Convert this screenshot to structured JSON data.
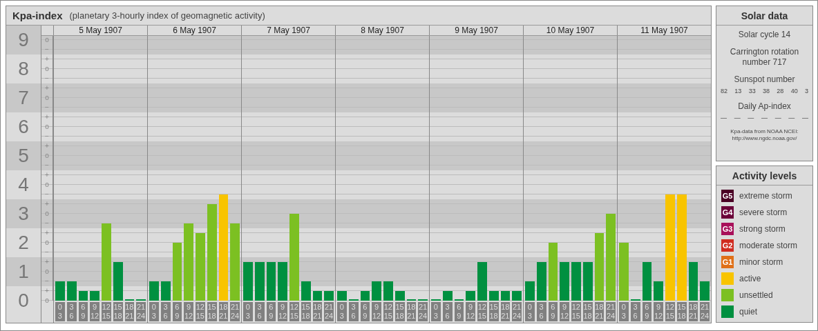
{
  "chart": {
    "title": "Kpa-index",
    "subtitle": "(planetary 3-hourly index of geomagnetic activity)",
    "scale": [
      {
        "major": "9",
        "minors": [
          "o",
          "−"
        ]
      },
      {
        "major": "8",
        "minors": [
          "+",
          "o",
          "−"
        ]
      },
      {
        "major": "7",
        "minors": [
          "+",
          "o",
          "−"
        ]
      },
      {
        "major": "6",
        "minors": [
          "+",
          "o",
          "−"
        ]
      },
      {
        "major": "5",
        "minors": [
          "+",
          "o",
          "−"
        ]
      },
      {
        "major": "4",
        "minors": [
          "+",
          "o",
          "−"
        ]
      },
      {
        "major": "3",
        "minors": [
          "+",
          "o",
          "−"
        ]
      },
      {
        "major": "2",
        "minors": [
          "+",
          "o",
          "−"
        ]
      },
      {
        "major": "1",
        "minors": [
          "+",
          "o",
          "−"
        ]
      },
      {
        "major": "0",
        "minors": [
          "+",
          "o"
        ]
      }
    ],
    "days": [
      {
        "date": "5 May 1907",
        "bars": [
          {
            "from": "0",
            "to": "3",
            "level": 0.074,
            "color": "#009040"
          },
          {
            "from": "3",
            "to": "6",
            "level": 0.074,
            "color": "#009040"
          },
          {
            "from": "6",
            "to": "9",
            "level": 0.037,
            "color": "#009040"
          },
          {
            "from": "9",
            "to": "12",
            "level": 0.037,
            "color": "#009040"
          },
          {
            "from": "12",
            "to": "15",
            "level": 0.296,
            "color": "#7cc022"
          },
          {
            "from": "15",
            "to": "18",
            "level": 0.148,
            "color": "#009040"
          },
          {
            "from": "18",
            "to": "21",
            "level": 0,
            "color": "#009040"
          },
          {
            "from": "21",
            "to": "24",
            "level": 0,
            "color": "#009040"
          }
        ]
      },
      {
        "date": "6 May 1907",
        "bars": [
          {
            "from": "0",
            "to": "3",
            "level": 0.074,
            "color": "#009040"
          },
          {
            "from": "3",
            "to": "6",
            "level": 0.074,
            "color": "#009040"
          },
          {
            "from": "6",
            "to": "9",
            "level": 0.222,
            "color": "#7cc022"
          },
          {
            "from": "9",
            "to": "12",
            "level": 0.296,
            "color": "#7cc022"
          },
          {
            "from": "12",
            "to": "15",
            "level": 0.259,
            "color": "#7cc022"
          },
          {
            "from": "15",
            "to": "18",
            "level": 0.37,
            "color": "#7cc022"
          },
          {
            "from": "18",
            "to": "21",
            "level": 0.407,
            "color": "#f8c400"
          },
          {
            "from": "21",
            "to": "24",
            "level": 0.296,
            "color": "#7cc022"
          }
        ]
      },
      {
        "date": "7 May 1907",
        "bars": [
          {
            "from": "0",
            "to": "3",
            "level": 0.148,
            "color": "#009040"
          },
          {
            "from": "3",
            "to": "6",
            "level": 0.148,
            "color": "#009040"
          },
          {
            "from": "6",
            "to": "9",
            "level": 0.148,
            "color": "#009040"
          },
          {
            "from": "9",
            "to": "12",
            "level": 0.148,
            "color": "#009040"
          },
          {
            "from": "12",
            "to": "15",
            "level": 0.333,
            "color": "#7cc022"
          },
          {
            "from": "15",
            "to": "18",
            "level": 0.074,
            "color": "#009040"
          },
          {
            "from": "18",
            "to": "21",
            "level": 0.037,
            "color": "#009040"
          },
          {
            "from": "21",
            "to": "24",
            "level": 0.037,
            "color": "#009040"
          }
        ]
      },
      {
        "date": "8 May 1907",
        "bars": [
          {
            "from": "0",
            "to": "3",
            "level": 0.037,
            "color": "#009040"
          },
          {
            "from": "3",
            "to": "6",
            "level": 0,
            "color": "#009040"
          },
          {
            "from": "6",
            "to": "9",
            "level": 0.037,
            "color": "#009040"
          },
          {
            "from": "9",
            "to": "12",
            "level": 0.074,
            "color": "#009040"
          },
          {
            "from": "12",
            "to": "15",
            "level": 0.074,
            "color": "#009040"
          },
          {
            "from": "15",
            "to": "18",
            "level": 0.037,
            "color": "#009040"
          },
          {
            "from": "18",
            "to": "21",
            "level": 0,
            "color": "#009040"
          },
          {
            "from": "21",
            "to": "24",
            "level": 0,
            "color": "#009040"
          }
        ]
      },
      {
        "date": "9 May 1907",
        "bars": [
          {
            "from": "0",
            "to": "3",
            "level": 0,
            "color": "#009040"
          },
          {
            "from": "3",
            "to": "6",
            "level": 0.037,
            "color": "#009040"
          },
          {
            "from": "6",
            "to": "9",
            "level": 0,
            "color": "#009040"
          },
          {
            "from": "9",
            "to": "12",
            "level": 0.037,
            "color": "#009040"
          },
          {
            "from": "12",
            "to": "15",
            "level": 0.148,
            "color": "#009040"
          },
          {
            "from": "15",
            "to": "18",
            "level": 0.037,
            "color": "#009040"
          },
          {
            "from": "18",
            "to": "21",
            "level": 0.037,
            "color": "#009040"
          },
          {
            "from": "21",
            "to": "24",
            "level": 0.037,
            "color": "#009040"
          }
        ]
      },
      {
        "date": "10 May 1907",
        "bars": [
          {
            "from": "0",
            "to": "3",
            "level": 0.074,
            "color": "#009040"
          },
          {
            "from": "3",
            "to": "6",
            "level": 0.148,
            "color": "#009040"
          },
          {
            "from": "6",
            "to": "9",
            "level": 0.222,
            "color": "#7cc022"
          },
          {
            "from": "9",
            "to": "12",
            "level": 0.148,
            "color": "#009040"
          },
          {
            "from": "12",
            "to": "15",
            "level": 0.148,
            "color": "#009040"
          },
          {
            "from": "15",
            "to": "18",
            "level": 0.148,
            "color": "#009040"
          },
          {
            "from": "18",
            "to": "21",
            "level": 0.259,
            "color": "#7cc022"
          },
          {
            "from": "21",
            "to": "24",
            "level": 0.333,
            "color": "#7cc022"
          }
        ]
      },
      {
        "date": "11 May 1907",
        "bars": [
          {
            "from": "0",
            "to": "3",
            "level": 0.222,
            "color": "#7cc022"
          },
          {
            "from": "3",
            "to": "6",
            "level": 0,
            "color": "#009040"
          },
          {
            "from": "6",
            "to": "9",
            "level": 0.148,
            "color": "#009040"
          },
          {
            "from": "9",
            "to": "12",
            "level": 0.074,
            "color": "#009040"
          },
          {
            "from": "12",
            "to": "15",
            "level": 0.407,
            "color": "#f8c400"
          },
          {
            "from": "15",
            "to": "18",
            "level": 0.407,
            "color": "#f8c400"
          },
          {
            "from": "18",
            "to": "21",
            "level": 0.148,
            "color": "#009040"
          },
          {
            "from": "21",
            "to": "24",
            "level": 0.074,
            "color": "#009040"
          }
        ]
      }
    ]
  },
  "solar_data": {
    "title": "Solar data",
    "cycle": "Solar cycle 14",
    "rotation": "Carrington rotation number 717",
    "sunspot_label": "Sunspot number",
    "sunspots": [
      "82",
      "13",
      "33",
      "38",
      "28",
      "40",
      "3"
    ],
    "ap_label": "Daily Ap-index",
    "ap_values": [
      "—",
      "—",
      "—",
      "—",
      "—",
      "—",
      "—"
    ],
    "source": "Kpa-data from NOAA NCEI:",
    "source_url": "http://www.ngdc.noaa.gov/"
  },
  "legend": {
    "title": "Activity levels",
    "items": [
      {
        "code": "G5",
        "label": "extreme storm",
        "color": "#4a0024"
      },
      {
        "code": "G4",
        "label": "severe storm",
        "color": "#6a0038"
      },
      {
        "code": "G3",
        "label": "strong storm",
        "color": "#a8105a"
      },
      {
        "code": "G2",
        "label": "moderate storm",
        "color": "#d02c20"
      },
      {
        "code": "G1",
        "label": "minor storm",
        "color": "#e07018"
      },
      {
        "label": "active",
        "color": "#f8c400"
      },
      {
        "label": "unsettled",
        "color": "#7cc022"
      },
      {
        "label": "quiet",
        "color": "#009040"
      }
    ]
  }
}
